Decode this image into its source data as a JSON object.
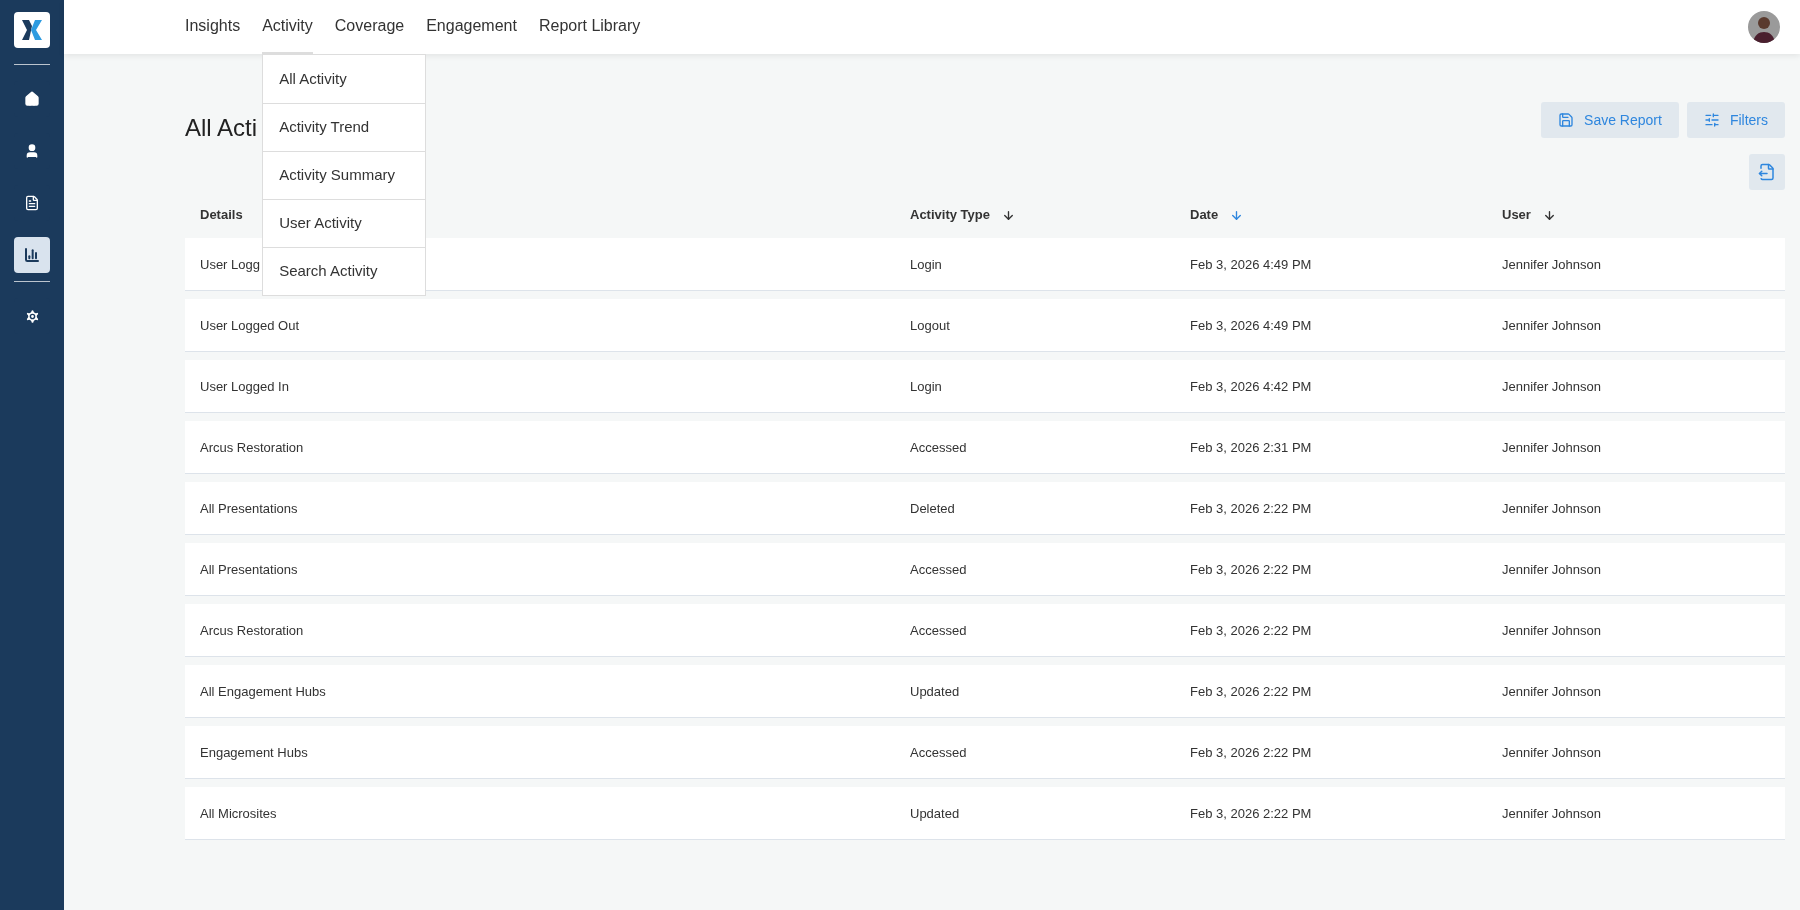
{
  "sidebar": {
    "groups": [
      [
        {
          "kind": "home",
          "selected": false
        },
        {
          "kind": "person",
          "selected": false
        },
        {
          "kind": "document",
          "selected": false
        },
        {
          "kind": "chart",
          "selected": true
        }
      ],
      [
        {
          "kind": "settings",
          "selected": false
        }
      ]
    ]
  },
  "nav": {
    "items": [
      {
        "label": "Insights",
        "selected": false
      },
      {
        "label": "Activity",
        "selected": true
      },
      {
        "label": "Coverage",
        "selected": false
      },
      {
        "label": "Engagement",
        "selected": false
      },
      {
        "label": "Report Library",
        "selected": false
      }
    ],
    "dropdown": [
      "All Activity",
      "Activity Trend",
      "Activity Summary",
      "User Activity",
      "Search Activity"
    ]
  },
  "page_title": "All Acti",
  "buttons": [
    {
      "kind": "save",
      "label": "Save Report"
    },
    {
      "kind": "filters",
      "label": "Filters"
    }
  ],
  "table": {
    "columns": [
      {
        "label": "Details",
        "kind": "plain"
      },
      {
        "label": "Activity Type",
        "kind": "sortable",
        "sorted": false
      },
      {
        "label": "Date",
        "kind": "sortable",
        "sorted": true
      },
      {
        "label": "User",
        "kind": "sortable",
        "sorted": false
      }
    ],
    "rows": [
      [
        "User Logg",
        "Login",
        "Feb 3, 2026 4:49 PM",
        "Jennifer Johnson"
      ],
      [
        "User Logged Out",
        "Logout",
        "Feb 3, 2026 4:49 PM",
        "Jennifer Johnson"
      ],
      [
        "User Logged In",
        "Login",
        "Feb 3, 2026 4:42 PM",
        "Jennifer Johnson"
      ],
      [
        "Arcus Restoration",
        "Accessed",
        "Feb 3, 2026 2:31 PM",
        "Jennifer Johnson"
      ],
      [
        "All Presentations",
        "Deleted",
        "Feb 3, 2026 2:22 PM",
        "Jennifer Johnson"
      ],
      [
        "All Presentations",
        "Accessed",
        "Feb 3, 2026 2:22 PM",
        "Jennifer Johnson"
      ],
      [
        "Arcus Restoration",
        "Accessed",
        "Feb 3, 2026 2:22 PM",
        "Jennifer Johnson"
      ],
      [
        "All Engagement Hubs",
        "Updated",
        "Feb 3, 2026 2:22 PM",
        "Jennifer Johnson"
      ],
      [
        "Engagement Hubs",
        "Accessed",
        "Feb 3, 2026 2:22 PM",
        "Jennifer Johnson"
      ],
      [
        "All Microsites",
        "Updated",
        "Feb 3, 2026 2:22 PM",
        "Jennifer Johnson"
      ]
    ]
  }
}
